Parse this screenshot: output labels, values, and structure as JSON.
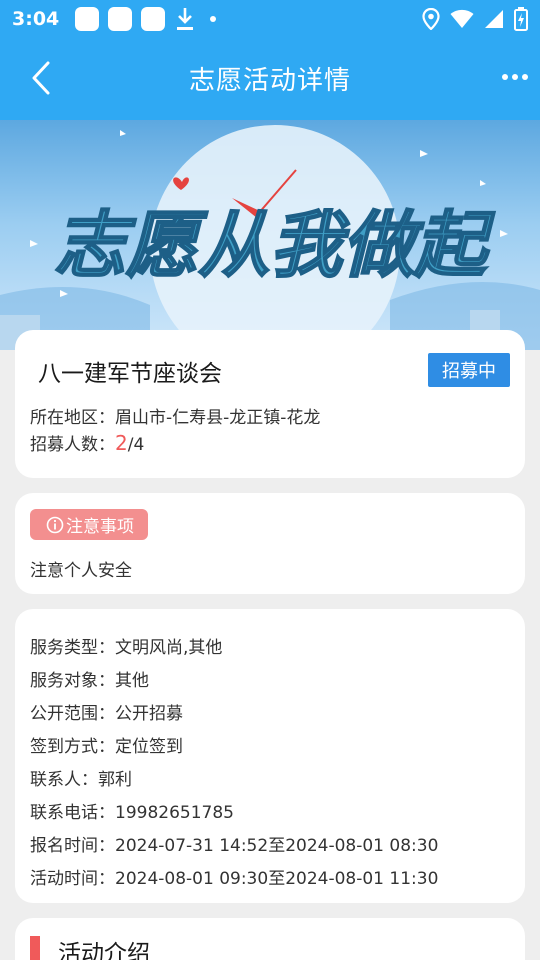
{
  "status_bar": {
    "time": "3:04"
  },
  "header": {
    "title": "志愿活动详情",
    "back_icon": "chevron-left-icon",
    "more_icon": "more-horizontal-icon"
  },
  "banner": {
    "slogan": "志愿从我做起"
  },
  "activity": {
    "title": "八一建军节座谈会",
    "status": "招募中",
    "region_label": "所在地区：",
    "region_value": "眉山市-仁寿县-龙正镇-花龙",
    "recruit_label": "招募人数：",
    "recruit_current": "2",
    "recruit_total": "/4"
  },
  "notice": {
    "badge": "注意事项",
    "text": "注意个人安全"
  },
  "details": [
    {
      "label": "服务类型：",
      "value": "文明风尚,其他"
    },
    {
      "label": "服务对象：",
      "value": "其他"
    },
    {
      "label": "公开范围：",
      "value": "公开招募"
    },
    {
      "label": "签到方式：",
      "value": "定位签到"
    },
    {
      "label": "联系人：",
      "value": "郭利"
    },
    {
      "label": "联系电话：",
      "value": "19982651785"
    },
    {
      "label": "报名时间：",
      "value": "2024-07-31 14:52至2024-08-01 08:30"
    },
    {
      "label": "活动时间：",
      "value": "2024-08-01 09:30至2024-08-01 11:30"
    }
  ],
  "intro": {
    "title": "活动介绍"
  },
  "colors": {
    "primary": "#2fa9f3",
    "badge_blue": "#2f8de4",
    "notice_red": "#f38f8f",
    "accent_red": "#f05a5a",
    "background": "#eeeeee"
  }
}
